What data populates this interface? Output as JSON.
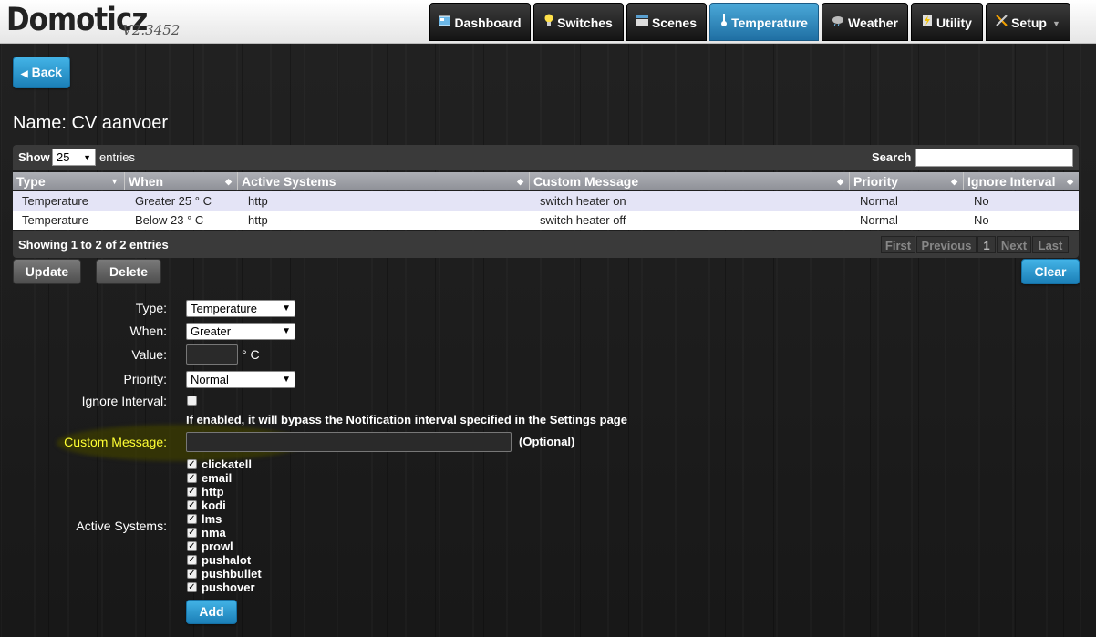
{
  "app": {
    "name": "Domoticz",
    "version": "V2.3452"
  },
  "nav": [
    {
      "label": "Dashboard",
      "icon": "dashboard-icon"
    },
    {
      "label": "Switches",
      "icon": "lightbulb-icon"
    },
    {
      "label": "Scenes",
      "icon": "clapperboard-icon"
    },
    {
      "label": "Temperature",
      "icon": "thermometer-icon",
      "active": true
    },
    {
      "label": "Weather",
      "icon": "rain-cloud-icon"
    },
    {
      "label": "Utility",
      "icon": "lightning-icon"
    },
    {
      "label": "Setup",
      "icon": "tools-icon",
      "dropdown": true
    }
  ],
  "back_label": "Back",
  "page_title": "Name: CV aanvoer",
  "table": {
    "show_label": "Show",
    "entries_value": "25",
    "entries_label": "entries",
    "search_label": "Search :",
    "search_value": "",
    "columns": [
      "Type",
      "When",
      "Active Systems",
      "Custom Message",
      "Priority",
      "Ignore Interval"
    ],
    "rows": [
      [
        "Temperature",
        "Greater 25 ° C",
        "http",
        "switch heater on",
        "Normal",
        "No"
      ],
      [
        "Temperature",
        "Below 23 ° C",
        "http",
        "switch heater off",
        "Normal",
        "No"
      ]
    ],
    "info": "Showing 1 to 2 of 2 entries",
    "pager": [
      "First",
      "Previous",
      "1",
      "Next",
      "Last"
    ]
  },
  "buttons": {
    "update": "Update",
    "delete": "Delete",
    "clear": "Clear",
    "add": "Add"
  },
  "form": {
    "type_label": "Type:",
    "type_value": "Temperature",
    "when_label": "When:",
    "when_value": "Greater",
    "value_label": "Value:",
    "value_value": "",
    "value_unit": "° C",
    "priority_label": "Priority:",
    "priority_value": "Normal",
    "ignore_label": "Ignore Interval:",
    "ignore_checked": false,
    "ignore_hint": "If enabled, it will bypass the Notification interval specified in the Settings page",
    "custom_label": "Custom Message:",
    "custom_value": "",
    "custom_optional": "(Optional)",
    "active_label": "Active Systems:",
    "systems": [
      "clickatell",
      "email",
      "http",
      "kodi",
      "lms",
      "nma",
      "prowl",
      "pushalot",
      "pushbullet",
      "pushover"
    ]
  },
  "colors": {
    "accent": "#2a8fcc",
    "highlight_label": "#ffff33"
  }
}
